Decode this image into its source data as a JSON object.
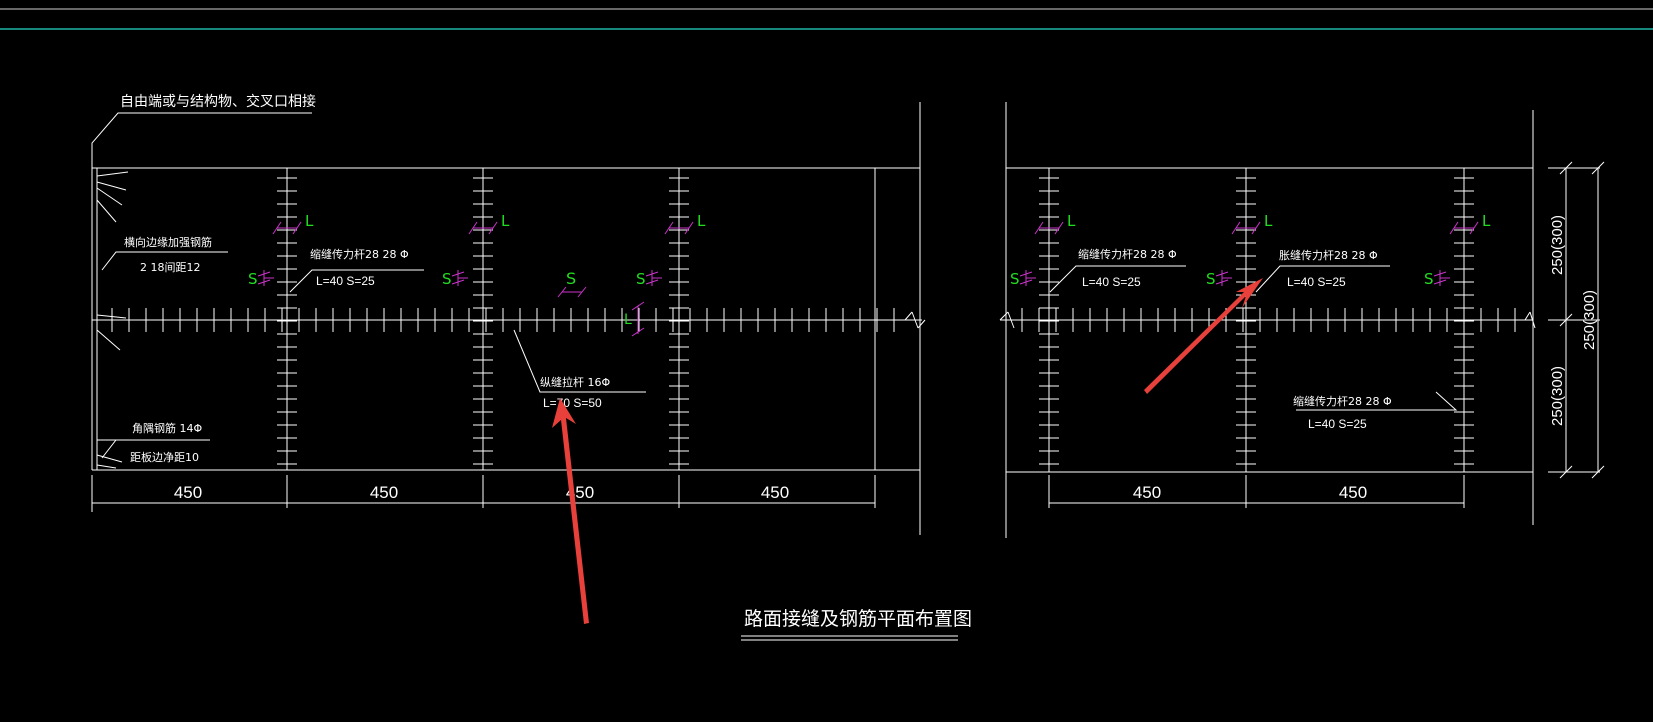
{
  "colors": {
    "background": "#000000",
    "line": "#ffffff",
    "frame_line": "#1fb5a8",
    "joint_marker": "#cc33cc",
    "marker_text": "#22dd22",
    "arrow": "#e8403a"
  },
  "drawing": {
    "title": "路面接缝及钢筋平面布置图",
    "left_panel": {
      "top_callout": "自由端或与结构物、交叉口相接",
      "edge_rebar_label_1": "横向边缘加强钢筋",
      "edge_rebar_label_2": "2 18间距12",
      "corner_rebar_label_1": "角隅钢筋 14Φ",
      "corner_rebar_label_2": "距板边净距10",
      "dowel_label_1": "缩缝传力杆28 28 Φ",
      "dowel_label_2": "L=40  S=25",
      "tie_bar_label_1": "纵缝拉杆  16Φ",
      "tie_bar_label_2": "L=70  S=50",
      "spacing_dims": [
        "450",
        "450",
        "450",
        "450"
      ]
    },
    "right_panel": {
      "dowel_label_a_1": "缩缝传力杆28 28 Φ",
      "dowel_label_a_2": "L=40  S=25",
      "dowel_label_b_1": "胀缝传力杆28 28 Φ",
      "dowel_label_b_2": "L=40  S=25",
      "dowel_label_c_1": "缩缝传力杆28 28 Φ",
      "dowel_label_c_2": "L=40  S=25",
      "spacing_dims": [
        "450",
        "450"
      ],
      "vertical_dims": [
        "250(300)",
        "250(300)",
        "250(300)"
      ]
    },
    "markers": {
      "length": "L",
      "spacing": "S"
    }
  }
}
